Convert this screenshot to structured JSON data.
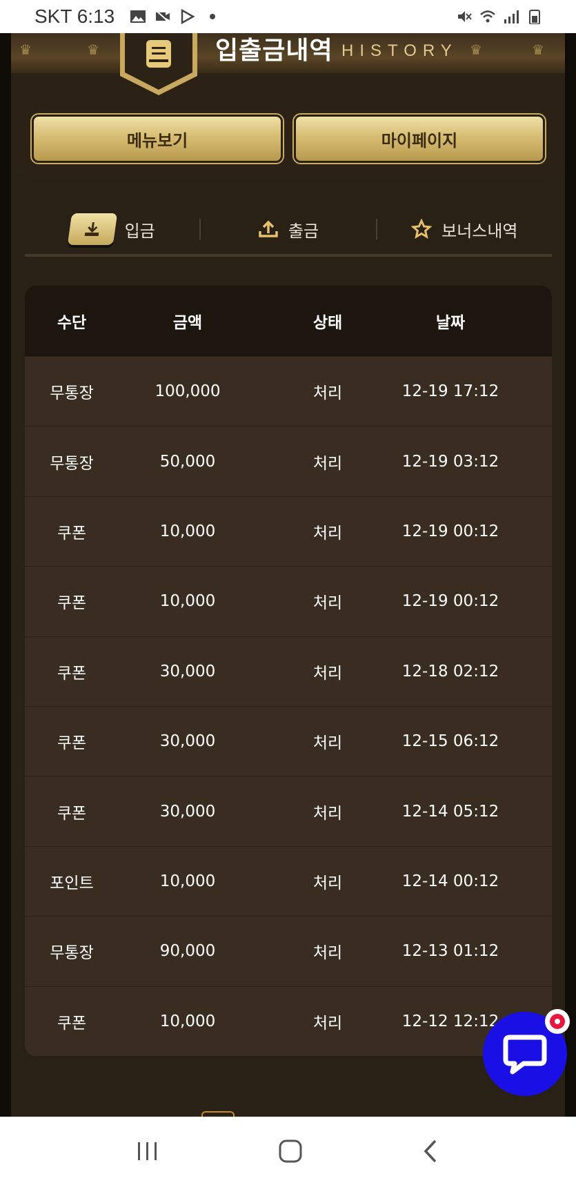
{
  "status_bar": {
    "carrier_time": "SKT 6:13"
  },
  "header": {
    "title": "입출금내역",
    "subtitle": "HISTORY",
    "menu_button": "메뉴보기",
    "mypage_button": "마이페이지"
  },
  "tabs": [
    {
      "label": "입금",
      "icon": "download-icon",
      "active": true
    },
    {
      "label": "출금",
      "icon": "upload-icon",
      "active": false
    },
    {
      "label": "보너스내역",
      "icon": "star-icon",
      "active": false
    }
  ],
  "table": {
    "headers": [
      "수단",
      "금액",
      "상태",
      "날짜"
    ],
    "rows": [
      {
        "method": "무통장",
        "amount": "100,000",
        "status": "처리",
        "date": "12-19 17:12"
      },
      {
        "method": "무통장",
        "amount": "50,000",
        "status": "처리",
        "date": "12-19 03:12"
      },
      {
        "method": "쿠폰",
        "amount": "10,000",
        "status": "처리",
        "date": "12-19 00:12"
      },
      {
        "method": "쿠폰",
        "amount": "10,000",
        "status": "처리",
        "date": "12-19 00:12"
      },
      {
        "method": "쿠폰",
        "amount": "30,000",
        "status": "처리",
        "date": "12-18 02:12"
      },
      {
        "method": "쿠폰",
        "amount": "30,000",
        "status": "처리",
        "date": "12-15 06:12"
      },
      {
        "method": "쿠폰",
        "amount": "30,000",
        "status": "처리",
        "date": "12-14 05:12"
      },
      {
        "method": "포인트",
        "amount": "10,000",
        "status": "처리",
        "date": "12-14 00:12"
      },
      {
        "method": "무통장",
        "amount": "90,000",
        "status": "처리",
        "date": "12-13 01:12"
      },
      {
        "method": "쿠폰",
        "amount": "10,000",
        "status": "처리",
        "date": "12-12 12:12"
      }
    ]
  },
  "colors": {
    "gold": "#d7bd73",
    "panel": "#2a2116",
    "chat": "#1a10e6",
    "badge": "#e8163e"
  }
}
